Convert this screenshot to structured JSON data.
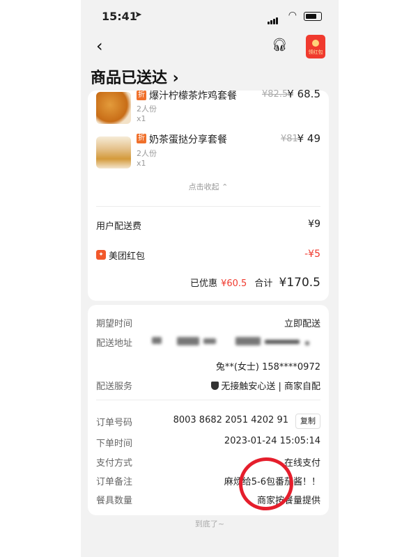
{
  "status_bar": {
    "time": "15:41"
  },
  "nav": {
    "redpacket_label": "领红包"
  },
  "page_title": "商品已送达 ›",
  "items": [
    {
      "name": "爆汁柠檬茶炸鸡套餐",
      "servings": "2人份",
      "qty": "x1",
      "original_price": "¥82.5",
      "price": "¥ 68.5",
      "discount_badge": "折"
    },
    {
      "name": "奶茶蛋挞分享套餐",
      "servings": "2人份",
      "qty": "x1",
      "original_price": "¥81",
      "price": "¥ 49",
      "discount_badge": "折"
    }
  ],
  "collapse_label": "点击收起 ⌃",
  "fees": {
    "delivery_fee_label": "用户配送费",
    "delivery_fee": "¥9",
    "redpacket_label": "美团红包",
    "redpacket_value": "-¥5"
  },
  "summary": {
    "saved_label": "已优惠",
    "saved_value": "¥60.5",
    "total_label": "合计",
    "total_value": "¥170.5"
  },
  "delivery": {
    "expected_time_label": "期望时间",
    "expected_time_value": "立即配送",
    "address_label": "配送地址",
    "contact": "兔**(女士) 158****0972",
    "service_label": "配送服务",
    "service_value": "无接触安心送 | 商家自配"
  },
  "order": {
    "number_label": "订单号码",
    "number_value": "8003 8682 2051 4202 91",
    "copy_label": "复制",
    "time_label": "下单时间",
    "time_value": "2023-01-24 15:05:14",
    "payment_label": "支付方式",
    "payment_value": "在线支付",
    "note_label": "订单备注",
    "note_value": "麻烦给5-6包番茄酱！！",
    "utensils_label": "餐具数量",
    "utensils_value": "商家按餐量提供"
  },
  "footer": "到底了~",
  "colors": {
    "accent_red": "#f03a2e",
    "badge_orange": "#f0702b",
    "annotation_red": "#e51e2c"
  }
}
